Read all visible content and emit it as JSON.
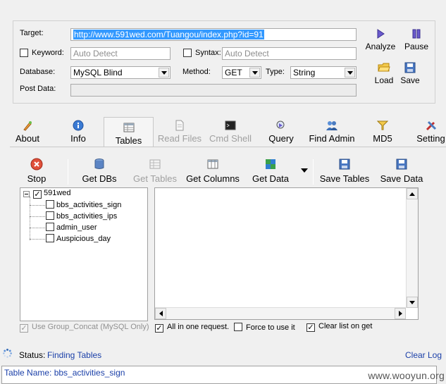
{
  "form": {
    "target_label": "Target:",
    "target_value": "http://www.591wed.com/Tuangou/index.php?id=91",
    "keyword_label": "Keyword:",
    "keyword_placeholder": "Auto Detect",
    "syntax_label": "Syntax:",
    "syntax_placeholder": "Auto Detect",
    "database_label": "Database:",
    "database_value": "MySQL Blind",
    "method_label": "Method:",
    "method_value": "GET",
    "type_label": "Type:",
    "type_value": "String",
    "postdata_label": "Post Data:",
    "postdata_value": ""
  },
  "actions": {
    "analyze": "Analyze",
    "pause": "Pause",
    "load": "Load",
    "save": "Save"
  },
  "tabs": [
    {
      "label": "About",
      "icon": "about-icon"
    },
    {
      "label": "Info",
      "icon": "info-icon"
    },
    {
      "label": "Tables",
      "icon": "tables-icon"
    },
    {
      "label": "Read Files",
      "icon": "read-files-icon"
    },
    {
      "label": "Cmd Shell",
      "icon": "cmd-shell-icon"
    },
    {
      "label": "Query",
      "icon": "query-icon"
    },
    {
      "label": "Find Admin",
      "icon": "find-admin-icon"
    },
    {
      "label": "MD5",
      "icon": "md5-icon"
    },
    {
      "label": "Setting",
      "icon": "setting-icon"
    }
  ],
  "toolbar": {
    "stop": "Stop",
    "get_dbs": "Get DBs",
    "get_tables": "Get Tables",
    "get_columns": "Get Columns",
    "get_data": "Get Data",
    "save_tables": "Save Tables",
    "save_data": "Save Data"
  },
  "tree": {
    "root": "591wed",
    "items": [
      "bbs_activities_sign",
      "bbs_activities_ips",
      "admin_user",
      "Auspicious_day"
    ]
  },
  "options": {
    "group_concat": "Use Group_Concat (MySQL Only)",
    "all_in_one": "All in one request.",
    "force": "Force to use it",
    "clear_list": "Clear list on get"
  },
  "status": {
    "label": "Status:",
    "value": "Finding Tables",
    "clear_log": "Clear Log"
  },
  "log": {
    "line": "Table Name: bbs_activities_sign"
  },
  "watermark": "www.wooyun.org",
  "colors": {
    "selection": "#3399ff",
    "link": "#1a3fa8",
    "background": "#f0f0f0"
  }
}
